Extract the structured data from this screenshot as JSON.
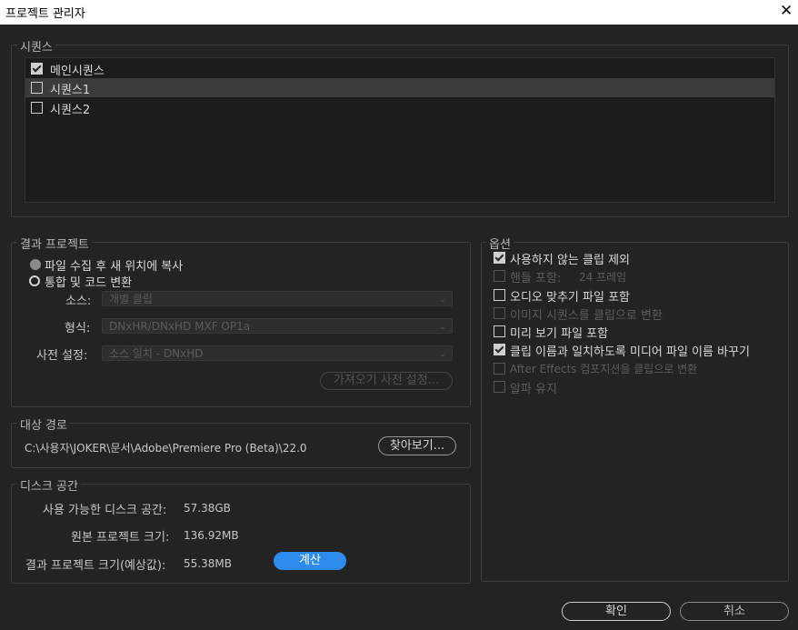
{
  "window": {
    "title": "프로젝트 관리자",
    "close_glyph": "✕"
  },
  "sequences": {
    "label": "시퀀스",
    "items": [
      {
        "label": "메인시퀀스",
        "checked": true
      },
      {
        "label": "시퀀스1",
        "checked": false
      },
      {
        "label": "시퀀스2",
        "checked": false
      }
    ]
  },
  "result_project": {
    "label": "결과 프로젝트",
    "radio_copy": "파일 수집 후 새 위치에 복사",
    "radio_consolidate": "통합 및 코드 변환",
    "source_label": "소스:",
    "source_value": "개별 클립",
    "format_label": "형식:",
    "format_value": "DNxHR/DNxHD MXF OP1a",
    "preset_label": "사전 설정:",
    "preset_value": "소스 일치 - DNxHD",
    "import_preset_button": "가져오기 사전 설정..."
  },
  "target_path": {
    "label": "대상 경로",
    "path": "C:\\사용자\\JOKER\\문서\\Adobe\\Premiere Pro (Beta)\\22.0",
    "browse_button": "찾아보기..."
  },
  "disk_space": {
    "label": "디스크 공간",
    "available_label": "사용 가능한 디스크 공간:",
    "available_value": "57.38GB",
    "original_label": "원본 프로젝트 크기:",
    "original_value": "136.92MB",
    "result_label": "결과 프로젝트 크기(예상값):",
    "result_value": "55.38MB",
    "calc_button": "계산"
  },
  "options": {
    "label": "옵션",
    "items": [
      {
        "label": "사용하지 않는 클립 제외",
        "checked": true,
        "enabled": true
      },
      {
        "label": "핸들 포함:",
        "extra": "24 프레임",
        "checked": false,
        "enabled": false
      },
      {
        "label": "오디오 맞추기 파일 포함",
        "checked": false,
        "enabled": true
      },
      {
        "label": "이미지 시퀀스를 클립으로 변환",
        "checked": false,
        "enabled": false
      },
      {
        "label": "미리 보기 파일 포함",
        "checked": false,
        "enabled": true
      },
      {
        "label": "클립 이름과 일치하도록 미디어 파일 이름 바꾸기",
        "checked": true,
        "enabled": true
      },
      {
        "label": "After Effects 컴포지션을 클립으로 변환",
        "checked": false,
        "enabled": false
      },
      {
        "label": "알파 유지",
        "checked": false,
        "enabled": false
      }
    ]
  },
  "footer": {
    "ok_button": "확인",
    "cancel_button": "취소"
  }
}
